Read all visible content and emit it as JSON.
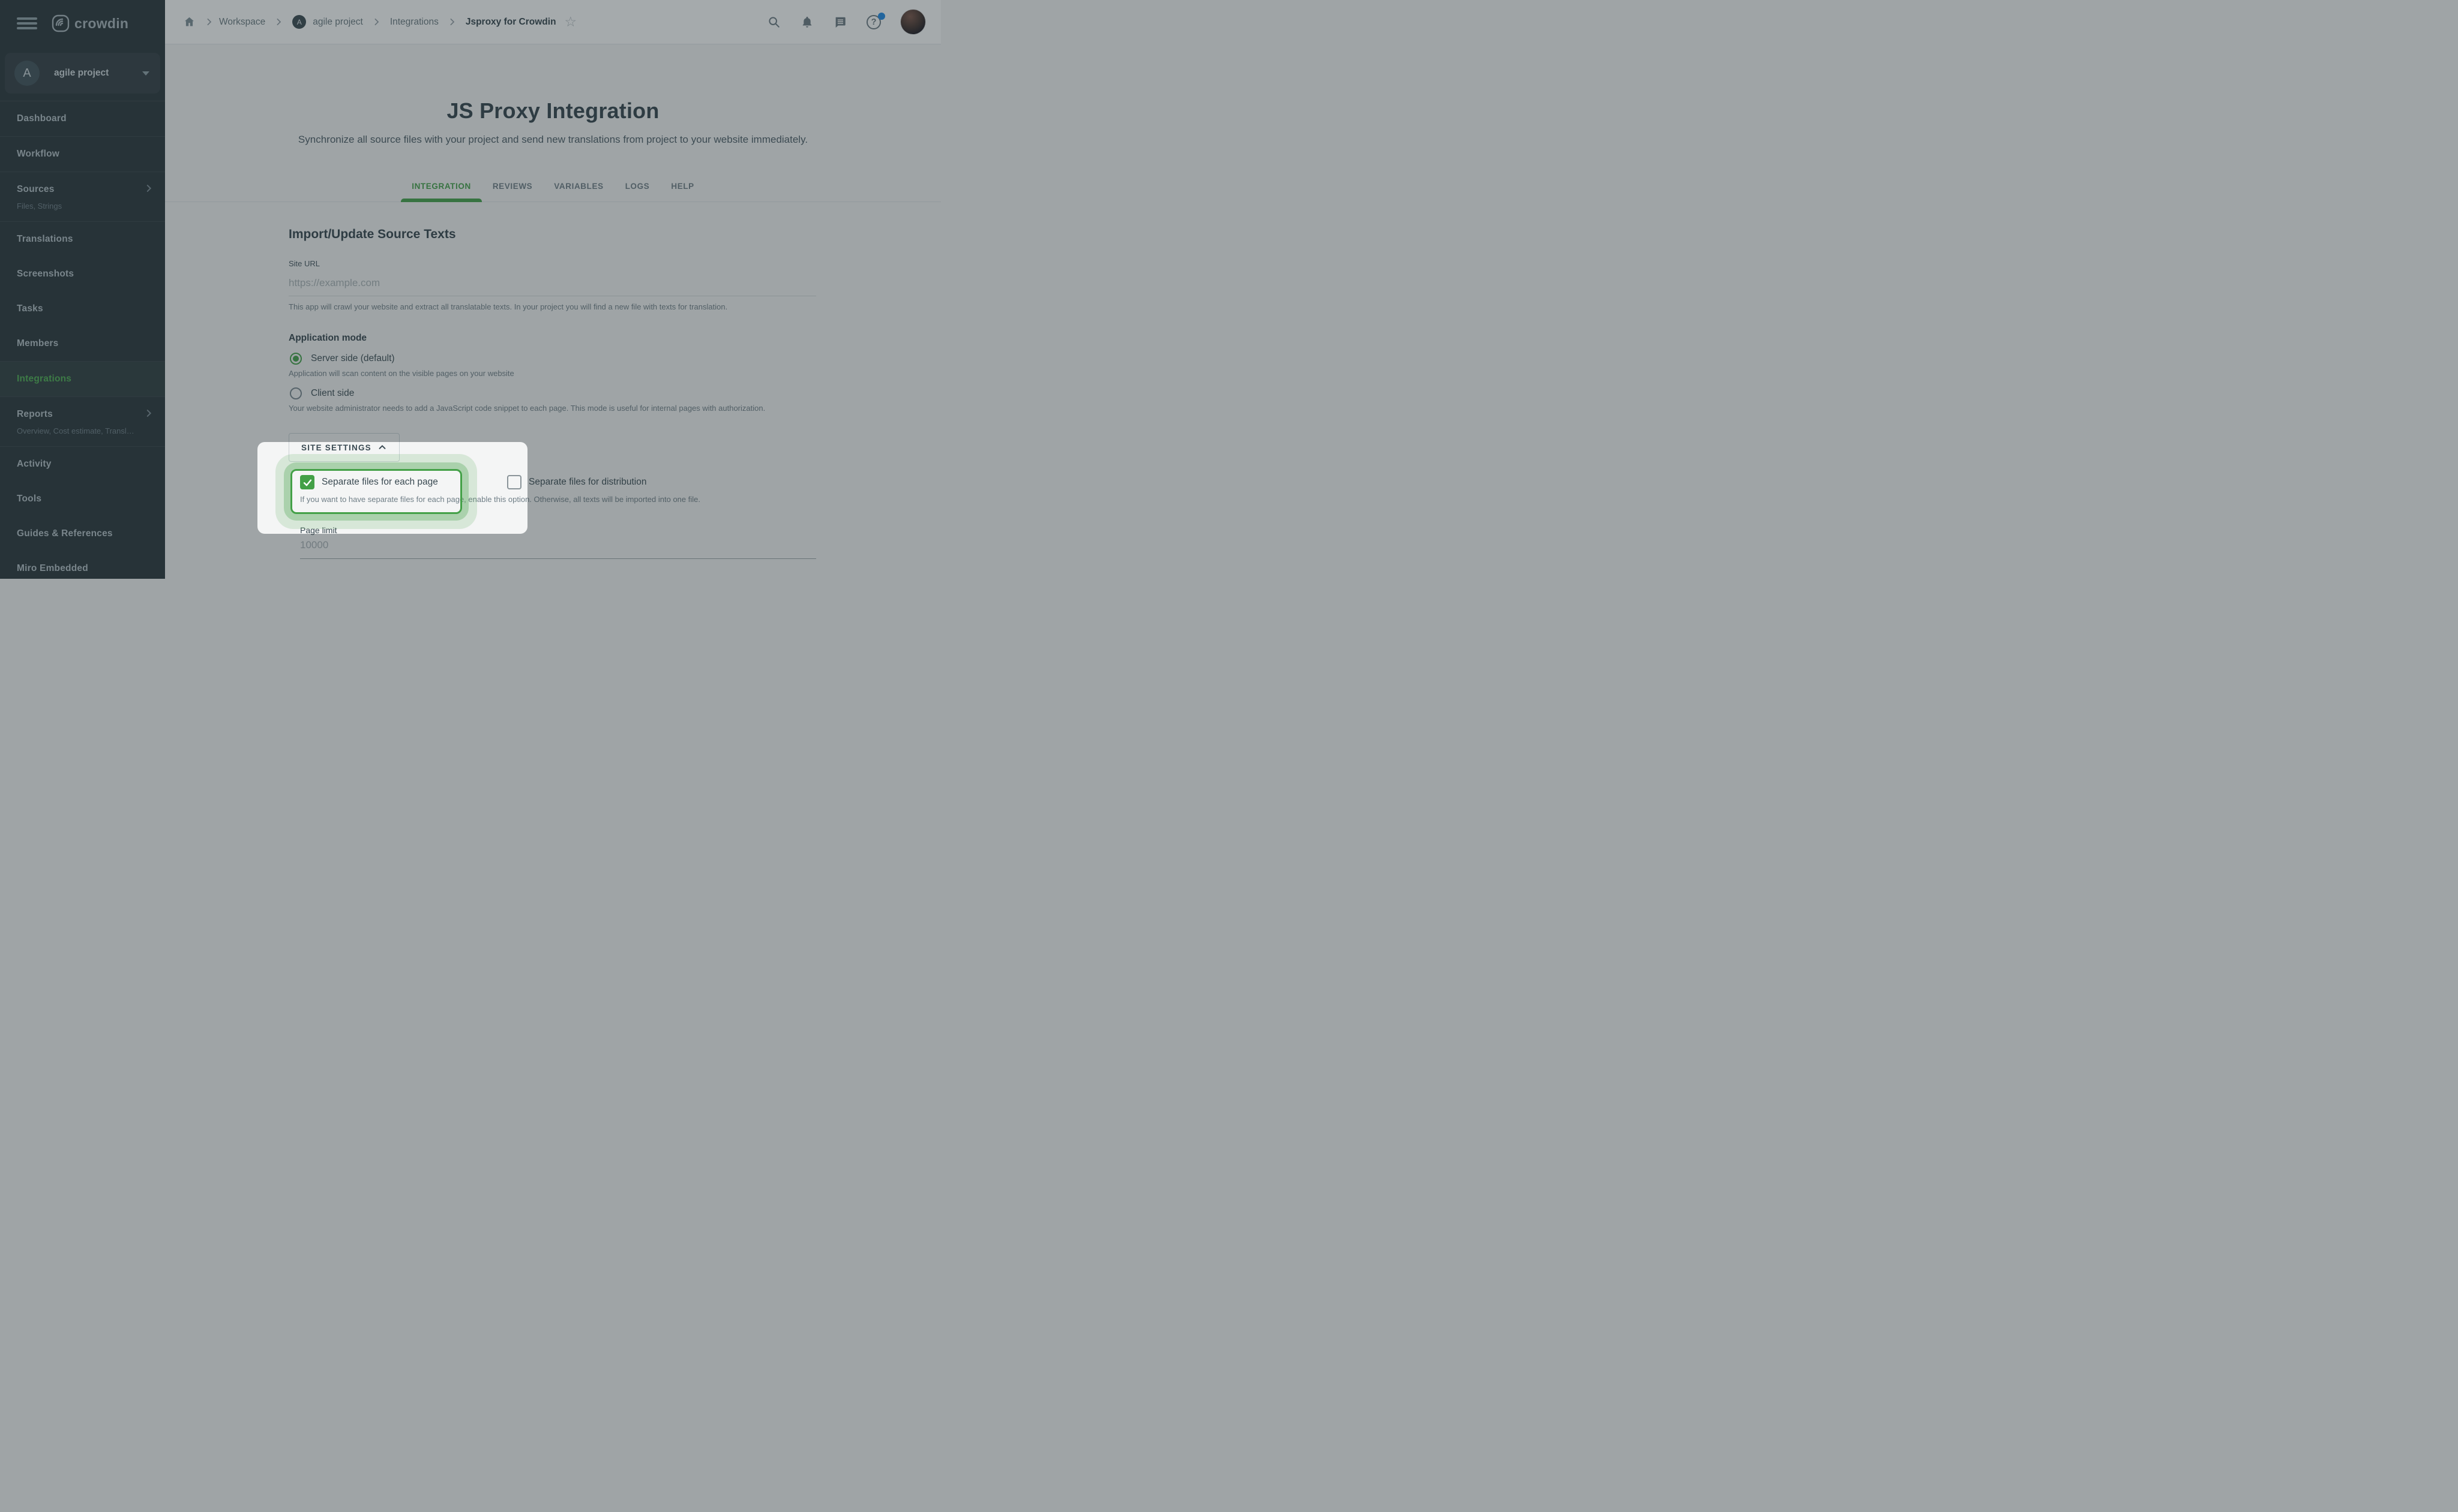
{
  "colors": {
    "accent_green": "#43a047",
    "sidebar_bg": "#263238",
    "overlay": "rgba(40,52,58,0.42)",
    "notification_blue": "#1e88e5"
  },
  "sidebar": {
    "logo_text": "crowdin",
    "project": {
      "avatar_letter": "A",
      "name": "agile project"
    },
    "items": [
      {
        "label": "Dashboard"
      },
      {
        "label": "Workflow"
      },
      {
        "label": "Sources",
        "subtitle": "Files, Strings"
      },
      {
        "label": "Translations"
      },
      {
        "label": "Screenshots"
      },
      {
        "label": "Tasks"
      },
      {
        "label": "Members"
      },
      {
        "label": "Integrations"
      },
      {
        "label": "Reports",
        "subtitle": "Overview, Cost estimate, Transl…"
      },
      {
        "label": "Activity"
      },
      {
        "label": "Tools"
      },
      {
        "label": "Guides & References"
      },
      {
        "label": "Miro Embedded"
      }
    ]
  },
  "header": {
    "breadcrumb": {
      "items": [
        {
          "label": "Workspace"
        },
        {
          "label": "agile project",
          "avatar_letter": "A"
        },
        {
          "label": "Integrations"
        },
        {
          "label": "Jsproxy for Crowdin"
        }
      ]
    },
    "icons": [
      "search",
      "notifications",
      "messages",
      "help"
    ],
    "star": "☆",
    "help_glyph": "?"
  },
  "hero": {
    "title": "JS Proxy Integration",
    "subtitle": "Synchronize all source files with your project and send new translations from project to your website immediately."
  },
  "tabs": {
    "items": [
      {
        "label": "INTEGRATION"
      },
      {
        "label": "REVIEWS"
      },
      {
        "label": "VARIABLES"
      },
      {
        "label": "LOGS"
      },
      {
        "label": "HELP"
      }
    ]
  },
  "form": {
    "section_title": "Import/Update Source Texts",
    "site_url": {
      "label": "Site URL",
      "placeholder": "https://example.com",
      "hint": "This app will crawl your website and extract all translatable texts. In your project you will find a new file with texts for translation."
    },
    "application_mode": {
      "label": "Application mode",
      "options": [
        {
          "label": "Server side (default)",
          "selected": true,
          "hint": "Application will scan content on the visible pages on your website"
        },
        {
          "label": "Client side",
          "selected": false,
          "hint": "Your website administrator needs to add a JavaScript code snippet to each page. This mode is useful for internal pages with authorization."
        }
      ]
    },
    "site_settings": {
      "toggle_label": "SITE SETTINGS",
      "checkboxes": [
        {
          "label": "Separate files for each page",
          "checked": true
        },
        {
          "label": "Separate files for distribution",
          "checked": false
        }
      ],
      "checkbox_hint": "If you want to have separate files for each page, enable this option. Otherwise, all texts will be imported into one file.",
      "page_limit": {
        "label": "Page limit",
        "value": "10000"
      }
    }
  }
}
